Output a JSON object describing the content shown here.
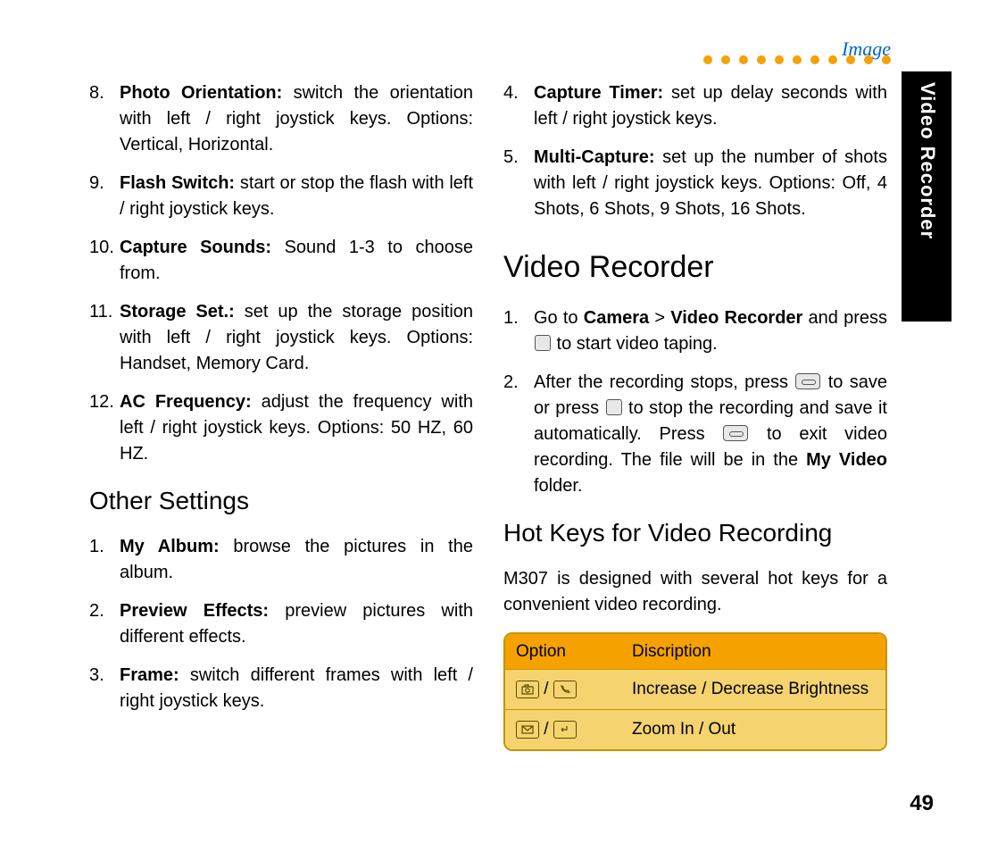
{
  "header": {
    "label": "Image"
  },
  "sideTab": "Video Recorder",
  "left": {
    "list1": [
      {
        "n": "8.",
        "b": "Photo Orientation:",
        "t": " switch the orientation with left / right joystick keys. Options: Vertical, Horizontal."
      },
      {
        "n": "9.",
        "b": "Flash Switch:",
        "t": " start or stop the flash with left / right joystick keys."
      },
      {
        "n": "10.",
        "b": "Capture Sounds:",
        "t": " Sound 1-3 to choose from."
      },
      {
        "n": "11.",
        "b": "Storage Set.:",
        "t": " set up the storage position with left / right joystick keys. Options: Handset, Memory Card."
      },
      {
        "n": "12.",
        "b": "AC Frequency:",
        "t": " adjust the frequency with left / right joystick keys. Options: 50 HZ, 60 HZ."
      }
    ],
    "h2": "Other Settings",
    "list2": [
      {
        "n": "1.",
        "b": "My Album:",
        "t": " browse the pictures in the album."
      },
      {
        "n": "2.",
        "b": "Preview Effects:",
        "t": " preview pictures with different effects."
      },
      {
        "n": "3.",
        "b": "Frame:",
        "t": " switch different frames with left / right joystick keys."
      }
    ]
  },
  "right": {
    "list1": [
      {
        "n": "4.",
        "b": "Capture Timer:",
        "t": " set up delay seconds with left / right joystick keys."
      },
      {
        "n": "5.",
        "b": "Multi-Capture:",
        "t": "  set up the number of shots with left / right joystick keys. Options: Off, 4 Shots, 6 Shots, 9 Shots, 16 Shots."
      }
    ],
    "h1": "Video Recorder",
    "step1": {
      "n": "1.",
      "pre": "Go to ",
      "b1": "Camera",
      "gt": " > ",
      "b2": "Video Recorder",
      "mid": " and press ",
      "post": " to start video taping."
    },
    "step2": {
      "n": "2.",
      "a": "After the recording stops, press ",
      "b": " to save or press ",
      "c": " to stop the recording and save it automatically. Press ",
      "d": " to exit video recording. The file will be in the ",
      "e": "My Video",
      "f": " folder."
    },
    "h2": "Hot Keys for Video Recording",
    "para": "M307 is designed with several hot keys for a convenient video recording.",
    "table": {
      "h1": "Option",
      "h2": "Discription",
      "rows": [
        {
          "desc": "Increase / Decrease Brightness"
        },
        {
          "desc": "Zoom In / Out"
        }
      ]
    }
  },
  "pageNumber": "49"
}
